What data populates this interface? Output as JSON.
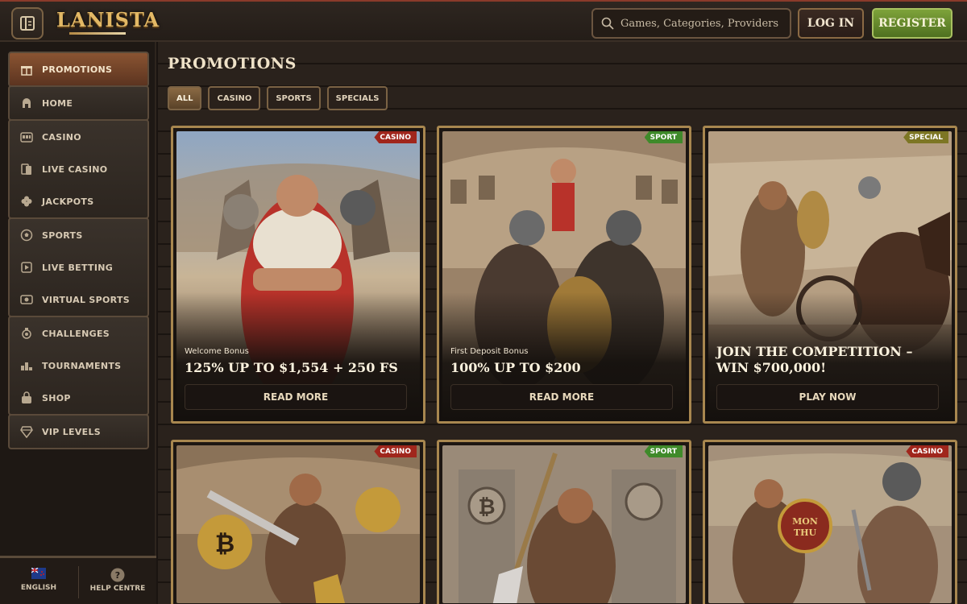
{
  "header": {
    "logo_text": "LANISTA",
    "search_placeholder": "Games, Categories, Providers",
    "login_label": "LOG IN",
    "register_label": "REGISTER"
  },
  "sidebar": {
    "groups": [
      {
        "items": [
          {
            "label": "PROMOTIONS",
            "icon": "gift-icon",
            "active": true
          }
        ]
      },
      {
        "items": [
          {
            "label": "HOME",
            "icon": "helmet-icon"
          }
        ]
      },
      {
        "items": [
          {
            "label": "CASINO",
            "icon": "slot-machine-icon"
          },
          {
            "label": "LIVE CASINO",
            "icon": "cards-icon"
          },
          {
            "label": "JACKPOTS",
            "icon": "clover-icon"
          }
        ]
      },
      {
        "items": [
          {
            "label": "SPORTS",
            "icon": "ball-icon"
          },
          {
            "label": "LIVE BETTING",
            "icon": "live-betting-icon"
          },
          {
            "label": "VIRTUAL SPORTS",
            "icon": "virtual-sports-icon"
          }
        ]
      },
      {
        "items": [
          {
            "label": "CHALLENGES",
            "icon": "medal-icon"
          },
          {
            "label": "TOURNAMENTS",
            "icon": "podium-icon"
          },
          {
            "label": "SHOP",
            "icon": "bag-icon"
          }
        ]
      },
      {
        "items": [
          {
            "label": "VIP LEVELS",
            "icon": "diamond-icon"
          }
        ]
      }
    ],
    "footer": {
      "language_label": "ENGLISH",
      "help_label": "HELP CENTRE"
    }
  },
  "main": {
    "title": "PROMOTIONS",
    "filters": [
      "ALL",
      "CASINO",
      "SPORTS",
      "SPECIALS"
    ],
    "active_filter": "ALL",
    "cards": [
      {
        "badge": "CASINO",
        "subtitle": "Welcome Bonus",
        "title": "125% UP TO $1,554 + 250 FS",
        "cta": "READ MORE"
      },
      {
        "badge": "SPORT",
        "subtitle": "First Deposit Bonus",
        "title": "100% UP TO $200",
        "cta": "READ MORE"
      },
      {
        "badge": "SPECIAL",
        "subtitle": "",
        "title": "JOIN THE COMPETITION – WIN $700,000!",
        "cta": "PLAY NOW"
      },
      {
        "badge": "CASINO"
      },
      {
        "badge": "SPORT"
      },
      {
        "badge": "CASINO"
      }
    ]
  },
  "colors": {
    "accent_gold": "#a8874f",
    "register_green": "#7ea33a",
    "active_nav": "#8a5432",
    "badge_casino": "#a0261c",
    "badge_sport": "#3f8a2a",
    "badge_special": "#7d7624"
  }
}
